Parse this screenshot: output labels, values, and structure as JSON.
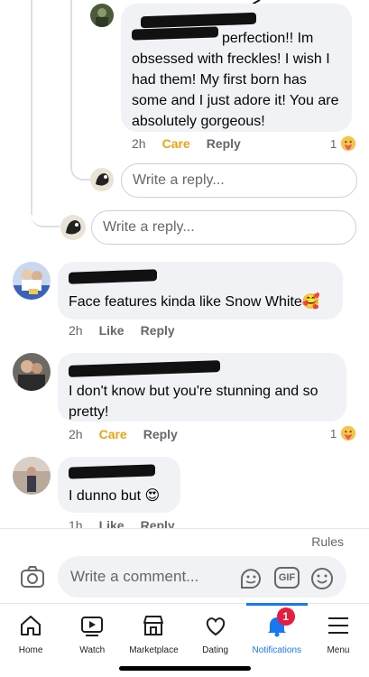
{
  "comments": [
    {
      "text": "perfection!! Im obsessed with freckles! I wish I had them! My first born has some and I just adore it! You are absolutely gorgeous!",
      "time": "2h",
      "reaction_label": "Care",
      "reply_label": "Reply",
      "reaction_count": "1",
      "reaction_icon": "care-emoji-icon"
    },
    {
      "text": "Face features kinda like Snow White🥰",
      "time": "2h",
      "like_label": "Like",
      "reply_label": "Reply"
    },
    {
      "text": "I don't know but you're stunning and so pretty!",
      "time": "2h",
      "reaction_label": "Care",
      "reply_label": "Reply",
      "reaction_count": "1",
      "reaction_icon": "care-emoji-icon"
    },
    {
      "text": "I dunno but 😍",
      "time": "1h",
      "like_label": "Like",
      "reply_label": "Reply"
    }
  ],
  "reply_placeholder_inner": "Write a reply...",
  "reply_placeholder_outer": "Write a reply...",
  "rules_label": "Rules",
  "composer": {
    "placeholder": "Write a comment...",
    "icons": [
      "camera-icon",
      "sticker-icon",
      "gif-icon",
      "emoji-icon"
    ],
    "gif_label": "GIF"
  },
  "nav": {
    "items": [
      {
        "label": "Home",
        "icon": "home-icon"
      },
      {
        "label": "Watch",
        "icon": "watch-icon"
      },
      {
        "label": "Marketplace",
        "icon": "marketplace-icon"
      },
      {
        "label": "Dating",
        "icon": "dating-icon"
      },
      {
        "label": "Notifications",
        "icon": "bell-icon",
        "badge": "1",
        "active": true
      },
      {
        "label": "Menu",
        "icon": "menu-icon"
      }
    ]
  },
  "colors": {
    "accent": "#1877f2",
    "care": "#e8a413",
    "badge": "#e41e3f",
    "bubble": "#f0f2f5"
  }
}
